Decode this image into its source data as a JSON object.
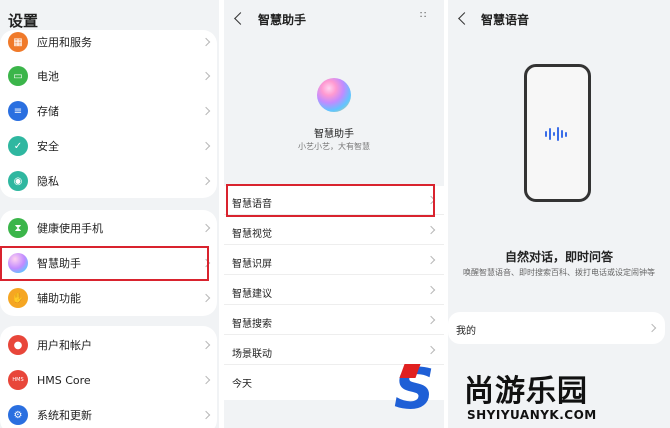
{
  "settings": {
    "title": "设置",
    "items": [
      {
        "label": "应用和服务",
        "icon": "apps-icon",
        "color": "#f07a2a"
      },
      {
        "label": "电池",
        "icon": "battery-icon",
        "color": "#3bb54a"
      },
      {
        "label": "存储",
        "icon": "storage-icon",
        "color": "#2a6fe0"
      },
      {
        "label": "安全",
        "icon": "shield-icon",
        "color": "#2fb7a0"
      },
      {
        "label": "隐私",
        "icon": "privacy-icon",
        "color": "#2fb7a0"
      },
      {
        "label": "健康使用手机",
        "icon": "hourglass-icon",
        "color": "#3bb54a"
      },
      {
        "label": "智慧助手",
        "icon": "assistant-orb-icon",
        "color": "#c28bff"
      },
      {
        "label": "辅助功能",
        "icon": "hand-icon",
        "color": "#f5a623"
      },
      {
        "label": "用户和帐户",
        "icon": "user-icon",
        "color": "#e8463a"
      },
      {
        "label": "HMS Core",
        "icon": "hms-icon",
        "color": "#e8463a"
      },
      {
        "label": "系统和更新",
        "icon": "system-gear-icon",
        "color": "#2a6fe0"
      }
    ]
  },
  "assistant": {
    "title": "智慧助手",
    "name": "智慧助手",
    "subtitle": "小艺小艺，大有智慧",
    "items": [
      "智慧语音",
      "智慧视觉",
      "智慧识屏",
      "智慧建议",
      "智慧搜索",
      "场景联动",
      "今天"
    ]
  },
  "voice": {
    "title": "智慧语音",
    "headline": "自然对话，即时问答",
    "description": "唤醒智慧语音、即时搜索百科、拨打电话或设定闹钟等",
    "mine_label": "我的"
  },
  "watermark": {
    "letter": "S",
    "name": "尚游乐园",
    "url": "SHYIYUANYK.COM"
  },
  "colors": {
    "highlight": "#d9232e",
    "accent": "#1e5fd6"
  }
}
